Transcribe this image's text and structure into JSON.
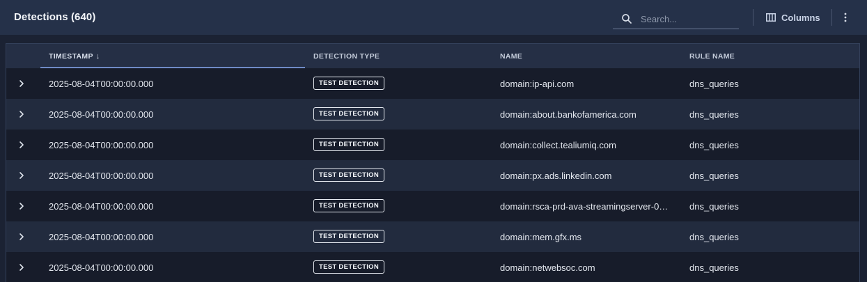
{
  "header": {
    "title": "Detections (640)",
    "search_placeholder": "Search...",
    "columns_label": "Columns"
  },
  "table": {
    "headers": {
      "timestamp": "TIMESTAMP",
      "timestamp_sort": "↓",
      "detection_type": "DETECTION TYPE",
      "name": "NAME",
      "rule_name": "RULE NAME"
    },
    "rows": [
      {
        "timestamp": "2025-08-04T00:00:00.000",
        "detection_type": "TEST DETECTION",
        "name": "domain:ip-api.com",
        "rule_name": "dns_queries"
      },
      {
        "timestamp": "2025-08-04T00:00:00.000",
        "detection_type": "TEST DETECTION",
        "name": "domain:about.bankofamerica.com",
        "rule_name": "dns_queries"
      },
      {
        "timestamp": "2025-08-04T00:00:00.000",
        "detection_type": "TEST DETECTION",
        "name": "domain:collect.tealiumiq.com",
        "rule_name": "dns_queries"
      },
      {
        "timestamp": "2025-08-04T00:00:00.000",
        "detection_type": "TEST DETECTION",
        "name": "domain:px.ads.linkedin.com",
        "rule_name": "dns_queries"
      },
      {
        "timestamp": "2025-08-04T00:00:00.000",
        "detection_type": "TEST DETECTION",
        "name": "domain:rsca-prd-ava-streamingserver-0…",
        "rule_name": "dns_queries"
      },
      {
        "timestamp": "2025-08-04T00:00:00.000",
        "detection_type": "TEST DETECTION",
        "name": "domain:mem.gfx.ms",
        "rule_name": "dns_queries"
      },
      {
        "timestamp": "2025-08-04T00:00:00.000",
        "detection_type": "TEST DETECTION",
        "name": "domain:netwebsoc.com",
        "rule_name": "dns_queries"
      }
    ]
  },
  "icons": {
    "search": "search-icon",
    "columns": "columns-icon",
    "more": "more-vertical-icon",
    "expand": "chevron-right-icon"
  },
  "colors": {
    "topbar": "#253149",
    "row_dark": "#171c2a",
    "row_light": "#222b3e",
    "sort_underline": "#6f8bc6"
  }
}
